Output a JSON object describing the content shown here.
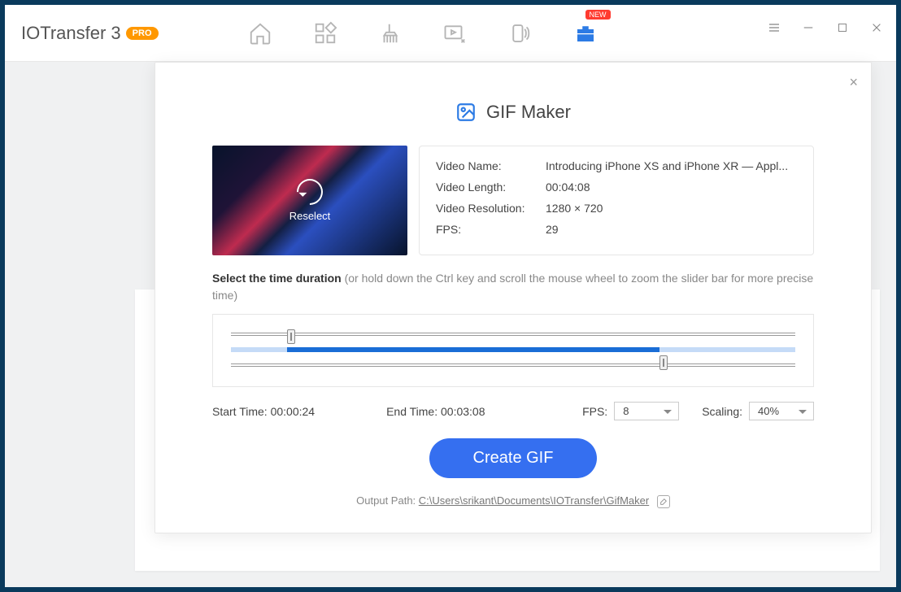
{
  "app": {
    "name": "IOTransfer 3",
    "badge": "PRO",
    "nav_new_badge": "NEW"
  },
  "modal": {
    "title": "GIF Maker",
    "close": "×",
    "thumb_overlay": "Reselect",
    "meta": {
      "name_label": "Video Name:",
      "name_value": "Introducing iPhone XS and iPhone XR — Appl...",
      "length_label": "Video Length:",
      "length_value": "00:04:08",
      "res_label": "Video Resolution:",
      "res_value": "1280 × 720",
      "fps_label": "FPS:",
      "fps_value": "29"
    },
    "instruction_bold": "Select the time duration",
    "instruction_rest": " (or hold down the Ctrl key and scroll the mouse wheel to zoom the slider bar for more precise time)",
    "start_label": "Start Time: ",
    "start_value": "00:00:24",
    "end_label": "End Time: ",
    "end_value": "00:03:08",
    "fps_sel_label": "FPS:",
    "fps_sel_value": "8",
    "scaling_label": "Scaling:",
    "scaling_value": "40%",
    "create_button": "Create GIF",
    "output_label": "Output Path: ",
    "output_path": "C:\\Users\\srikant\\Documents\\IOTransfer\\GifMaker"
  },
  "slider": {
    "start_pct": 10,
    "end_pct": 76
  }
}
